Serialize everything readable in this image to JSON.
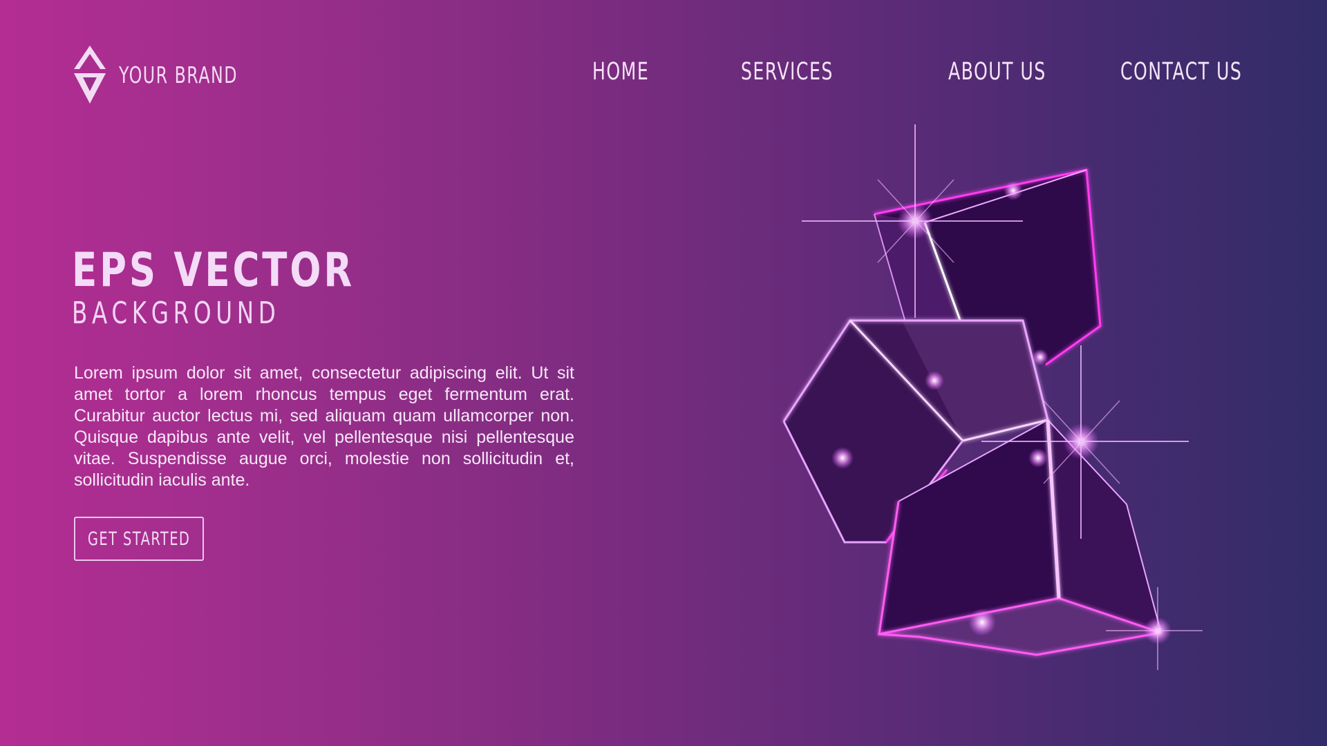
{
  "brand": {
    "name": "YOUR BRAND",
    "logo_icon": "diamond-logo-icon"
  },
  "nav": {
    "items": [
      {
        "label": "HOME"
      },
      {
        "label": "SERVICES"
      },
      {
        "label": "ABOUT US"
      },
      {
        "label": "CONTACT US"
      }
    ]
  },
  "hero": {
    "title": "EPS VECTOR",
    "subtitle": "BACKGROUND",
    "body": "Lorem ipsum dolor sit amet, consectetur adipiscing elit. Ut sit amet tortor a lorem rhoncus tempus eget fermentum erat. Curabitur auctor lectus mi, sed aliquam quam ullamcorper non. Quisque dapibus ante velit, vel pellentesque nisi pellentesque vitae. Suspendisse augue orci, molestie non sollicitudin et, sollicitudin iaculis ante.",
    "cta_label": "GET STARTED"
  },
  "illustration": {
    "name": "glowing-cubes-illustration"
  },
  "colors": {
    "gradient_left": "#b42d93",
    "gradient_right": "#322c68",
    "text": "#f2d9f4",
    "glow": "#f070ff"
  }
}
